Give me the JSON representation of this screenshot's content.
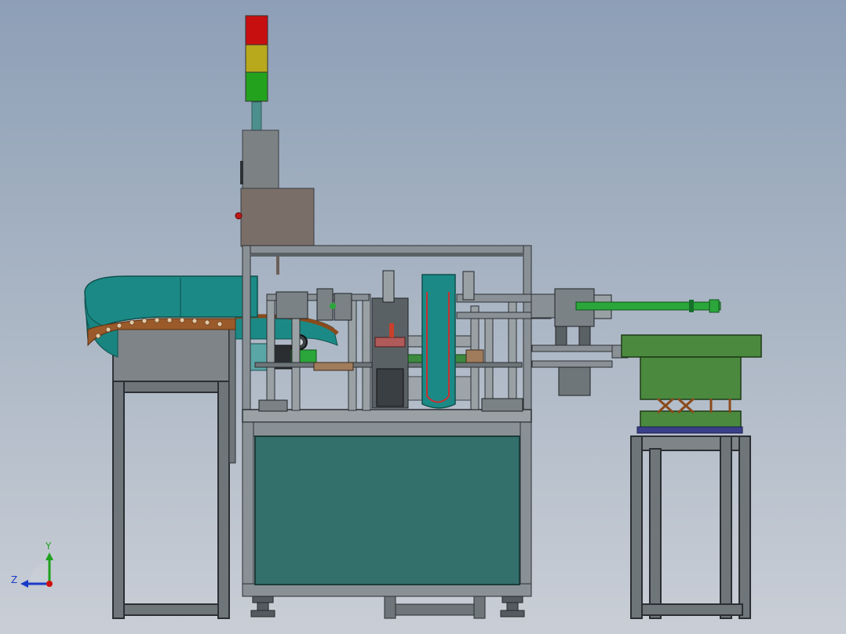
{
  "view": {
    "background_top": "#8d9fb7",
    "background_bottom": "#c9ced6",
    "frame_color": "#707a80",
    "frame_dark": "#2e3338",
    "panel_teal": "#33706c",
    "feeder_teal": "#1b8a86",
    "bowl_green": "#4b8a3e",
    "cylinder_green": "#2aa63a",
    "stack_light": [
      "#c80f10",
      "#b8a81c",
      "#23a31d"
    ]
  },
  "triad": {
    "y_label": "Y",
    "z_label": "Z",
    "y_color": "#1ea11e",
    "z_color": "#1a3bc8",
    "origin_color": "#d01010"
  }
}
